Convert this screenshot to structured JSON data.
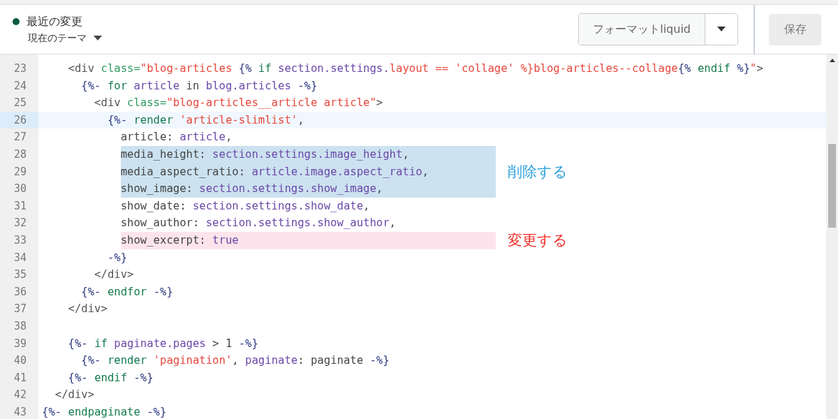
{
  "header": {
    "title": "最近の変更",
    "theme_dropdown": "現在のテーマ",
    "format_button": "フォーマットliquid",
    "save_button": {
      "label": "保存",
      "disabled": true
    }
  },
  "editor": {
    "lines": [
      {
        "number": "23",
        "current": false,
        "tokens": [
          {
            "kind": "tag",
            "text": "    <div "
          },
          {
            "kind": "attr",
            "text": "class="
          },
          {
            "kind": "string",
            "text": "\"blog-articles "
          },
          {
            "kind": "delim",
            "text": "{% "
          },
          {
            "kind": "keyword",
            "text": "if "
          },
          {
            "kind": "variable",
            "text": "section.settings."
          },
          {
            "kind": "string",
            "text": "layout == 'collage' %}blog-articles--collage"
          },
          {
            "kind": "delim",
            "text": "{% "
          },
          {
            "kind": "keyword",
            "text": "endif "
          },
          {
            "kind": "delim",
            "text": "%}"
          },
          {
            "kind": "string",
            "text": "\""
          },
          {
            "kind": "tag",
            "text": ">"
          }
        ]
      },
      {
        "number": "24",
        "current": false,
        "tokens": [
          {
            "kind": "delim",
            "text": "      {%- "
          },
          {
            "kind": "keyword",
            "text": "for "
          },
          {
            "kind": "variable",
            "text": "article"
          },
          {
            "kind": "plain",
            "text": " in "
          },
          {
            "kind": "variable",
            "text": "blog.articles"
          },
          {
            "kind": "delim",
            "text": " -%}"
          }
        ]
      },
      {
        "number": "25",
        "current": false,
        "tokens": [
          {
            "kind": "tag",
            "text": "        <div "
          },
          {
            "kind": "attr",
            "text": "class="
          },
          {
            "kind": "string",
            "text": "\"blog-articles__article article\""
          },
          {
            "kind": "tag",
            "text": ">"
          }
        ]
      },
      {
        "number": "26",
        "current": true,
        "tokens": [
          {
            "kind": "delim",
            "text": "          {%- "
          },
          {
            "kind": "keyword",
            "text": "render "
          },
          {
            "kind": "string",
            "text": "'article-slimlist'"
          },
          {
            "kind": "plain",
            "text": ","
          }
        ]
      },
      {
        "number": "27",
        "current": false,
        "tokens": [
          {
            "kind": "plain",
            "text": "            article: "
          },
          {
            "kind": "variable",
            "text": "article"
          },
          {
            "kind": "plain",
            "text": ","
          }
        ]
      },
      {
        "number": "28",
        "current": false,
        "kind": "delete",
        "tokens": [
          {
            "kind": "plain",
            "text": "            media_height: "
          },
          {
            "kind": "variable",
            "text": "section.settings.image_height"
          },
          {
            "kind": "plain",
            "text": ","
          }
        ]
      },
      {
        "number": "29",
        "current": false,
        "kind": "delete",
        "note": "削除する",
        "tokens": [
          {
            "kind": "plain",
            "text": "            media_aspect_ratio: "
          },
          {
            "kind": "variable",
            "text": "article.image.aspect_ratio"
          },
          {
            "kind": "plain",
            "text": ","
          }
        ]
      },
      {
        "number": "30",
        "current": false,
        "kind": "delete",
        "tokens": [
          {
            "kind": "plain",
            "text": "            show_image: "
          },
          {
            "kind": "variable",
            "text": "section.settings.show_image"
          },
          {
            "kind": "plain",
            "text": ","
          }
        ]
      },
      {
        "number": "31",
        "current": false,
        "tokens": [
          {
            "kind": "plain",
            "text": "            show_date: "
          },
          {
            "kind": "variable",
            "text": "section.settings.show_date"
          },
          {
            "kind": "plain",
            "text": ","
          }
        ]
      },
      {
        "number": "32",
        "current": false,
        "tokens": [
          {
            "kind": "plain",
            "text": "            show_author: "
          },
          {
            "kind": "variable",
            "text": "section.settings.show_author"
          },
          {
            "kind": "plain",
            "text": ","
          }
        ]
      },
      {
        "number": "33",
        "current": false,
        "kind": "change",
        "note": "変更する",
        "tokens": [
          {
            "kind": "plain",
            "text": "            show_excerpt: "
          },
          {
            "kind": "variable",
            "text": "true"
          }
        ]
      },
      {
        "number": "34",
        "current": false,
        "tokens": [
          {
            "kind": "delim",
            "text": "          -%}"
          }
        ]
      },
      {
        "number": "35",
        "current": false,
        "tokens": [
          {
            "kind": "tag",
            "text": "        </div>"
          }
        ]
      },
      {
        "number": "36",
        "current": false,
        "tokens": [
          {
            "kind": "delim",
            "text": "      {%- "
          },
          {
            "kind": "keyword",
            "text": "endfor "
          },
          {
            "kind": "delim",
            "text": "-%}"
          }
        ]
      },
      {
        "number": "37",
        "current": false,
        "tokens": [
          {
            "kind": "tag",
            "text": "    </div>"
          }
        ]
      },
      {
        "number": "38",
        "current": false
      },
      {
        "number": "39",
        "current": false,
        "tokens": [
          {
            "kind": "delim",
            "text": "    {%- "
          },
          {
            "kind": "keyword",
            "text": "if "
          },
          {
            "kind": "variable",
            "text": "paginate.pages"
          },
          {
            "kind": "plain",
            "text": " > 1 "
          },
          {
            "kind": "delim",
            "text": "-%}"
          }
        ]
      },
      {
        "number": "40",
        "current": false,
        "tokens": [
          {
            "kind": "delim",
            "text": "      {%- "
          },
          {
            "kind": "keyword",
            "text": "render "
          },
          {
            "kind": "string",
            "text": "'pagination'"
          },
          {
            "kind": "plain",
            "text": ", "
          },
          {
            "kind": "variable",
            "text": "paginate"
          },
          {
            "kind": "plain",
            "text": ": paginate "
          },
          {
            "kind": "delim",
            "text": "-%}"
          }
        ]
      },
      {
        "number": "41",
        "current": false,
        "tokens": [
          {
            "kind": "delim",
            "text": "    {%- "
          },
          {
            "kind": "keyword",
            "text": "endif "
          },
          {
            "kind": "delim",
            "text": "-%}"
          }
        ]
      },
      {
        "number": "42",
        "current": false,
        "tokens": [
          {
            "kind": "tag",
            "text": "  </div>"
          }
        ]
      },
      {
        "number": "43",
        "current": false,
        "tokens": [
          {
            "kind": "delim",
            "text": "{%- "
          },
          {
            "kind": "keyword",
            "text": "endpaginate "
          },
          {
            "kind": "delim",
            "text": "-%}"
          }
        ]
      }
    ]
  }
}
